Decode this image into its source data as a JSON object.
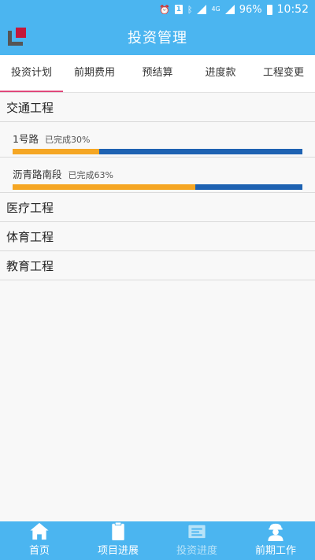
{
  "status_bar": {
    "sim_label": "1",
    "net_label": "4G",
    "battery": "96%",
    "time": "10:52"
  },
  "app_bar": {
    "title": "投资管理"
  },
  "tabs": [
    {
      "label": "投资计划",
      "active": true
    },
    {
      "label": "前期费用",
      "active": false
    },
    {
      "label": "预结算",
      "active": false
    },
    {
      "label": "进度款",
      "active": false
    },
    {
      "label": "工程变更",
      "active": false
    }
  ],
  "categories": {
    "traffic": {
      "label": "交通工程",
      "projects": [
        {
          "name": "1号路",
          "status": "已完成30%",
          "progress": 0.3
        },
        {
          "name": "沥青路南段",
          "status": "已完成63%",
          "progress": 0.63
        }
      ]
    },
    "medical": {
      "label": "医疗工程"
    },
    "sports": {
      "label": "体育工程"
    },
    "education": {
      "label": "教育工程"
    }
  },
  "bottom_nav": [
    {
      "label": "首页",
      "icon": "home-icon",
      "active": false
    },
    {
      "label": "项目进展",
      "icon": "clipboard-icon",
      "active": false
    },
    {
      "label": "投资进度",
      "icon": "document-icon",
      "active": true
    },
    {
      "label": "前期工作",
      "icon": "worker-icon",
      "active": false
    }
  ],
  "colors": {
    "primary": "#4bb5f0",
    "tab_indicator": "#e0487a",
    "progress_done": "#f5a623",
    "progress_remaining": "#1e62b2",
    "nav_active": "#b8e3f8"
  }
}
